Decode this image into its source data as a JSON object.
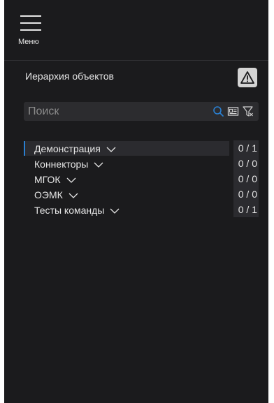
{
  "menu": {
    "label": "Меню",
    "icon": "hamburger-icon"
  },
  "panel": {
    "title": "Иерархия объектов",
    "warning_icon": "warning-triangle-icon"
  },
  "search": {
    "placeholder": "Поиск",
    "value": "",
    "icons": [
      "search-icon",
      "id-card-icon",
      "filter-icon"
    ]
  },
  "tree": {
    "items": [
      {
        "label": "Демонстрация",
        "count": "0 / 1",
        "selected": true
      },
      {
        "label": "Коннекторы",
        "count": "0 / 0",
        "selected": false
      },
      {
        "label": "МГОК",
        "count": "0 / 0",
        "selected": false
      },
      {
        "label": "ОЭМК",
        "count": "0 / 0",
        "selected": false
      },
      {
        "label": "Тесты команды",
        "count": "0 / 1",
        "selected": false
      }
    ]
  },
  "colors": {
    "panel_bg": "#1b1b1d",
    "accent": "#2a7fd0",
    "text": "#e6e6e6"
  }
}
